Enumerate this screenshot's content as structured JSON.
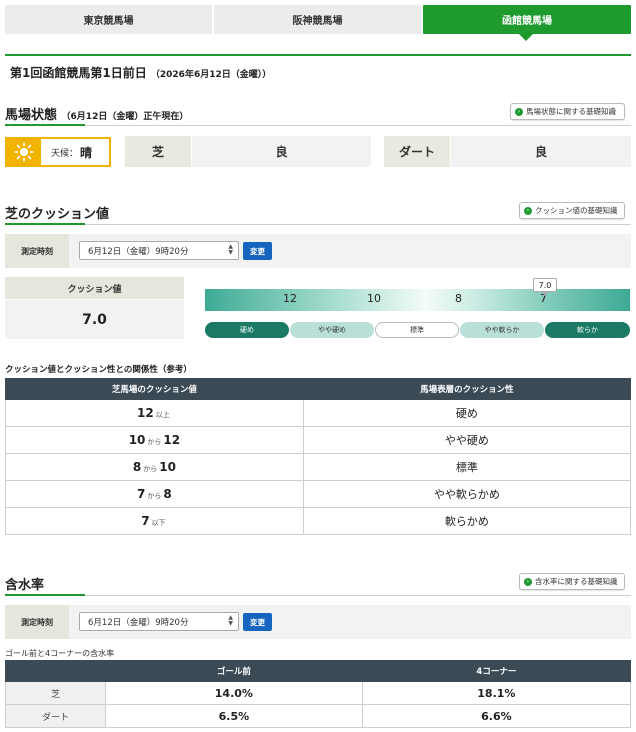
{
  "tabs": [
    {
      "label": "東京競馬場",
      "active": false
    },
    {
      "label": "阪神競馬場",
      "active": false
    },
    {
      "label": "函館競馬場",
      "active": true
    }
  ],
  "page_title": "第1回函館競馬第1日前日",
  "page_title_date": "（2026年6月12日（金曜））",
  "track_condition": {
    "title": "馬場状態",
    "as_of": "（6月12日（金曜）正午現在）",
    "info_button": "馬場状態に関する基礎知識",
    "weather_label": "天候：",
    "weather_value": "晴",
    "turf_label": "芝",
    "turf_value": "良",
    "dirt_label": "ダート",
    "dirt_value": "良"
  },
  "cushion": {
    "title": "芝のクッション値",
    "info_button": "クッション値の基礎知識",
    "measure_label": "測定時刻",
    "measure_value": "6月12日（金曜）9時20分",
    "change_button": "変更",
    "value_label": "クッション値",
    "value": "7.0",
    "scale_numbers": [
      "12",
      "10",
      "8",
      "7"
    ],
    "marker": "7.0",
    "categories": [
      "硬め",
      "やや硬め",
      "標準",
      "やや軟らか",
      "軟らか"
    ],
    "current_fraction": 0.8
  },
  "relation": {
    "title": "クッション値とクッション性との関係性（参考）",
    "headers": [
      "芝馬場のクッション値",
      "馬場表層のクッション性"
    ],
    "rows": [
      {
        "a": "12",
        "conj": "以上",
        "b": "",
        "result": "硬め"
      },
      {
        "a": "10",
        "conj": "から",
        "b": "12",
        "result": "やや硬め"
      },
      {
        "a": "8",
        "conj": "から",
        "b": "10",
        "result": "標準"
      },
      {
        "a": "7",
        "conj": "から",
        "b": "8",
        "result": "やや軟らかめ"
      },
      {
        "a": "7",
        "conj": "以下",
        "b": "",
        "result": "軟らかめ"
      }
    ]
  },
  "moisture": {
    "title": "含水率",
    "info_button": "含水率に関する基礎知識",
    "measure_label": "測定時刻",
    "measure_value": "6月12日（金曜）9時20分",
    "change_button": "変更",
    "note": "ゴール前と4コーナーの含水率",
    "headers": [
      "",
      "ゴール前",
      "4コーナー"
    ],
    "rows": [
      {
        "label": "芝",
        "goal": "14.0%",
        "corner": "18.1%"
      },
      {
        "label": "ダート",
        "goal": "6.5%",
        "corner": "6.6%"
      }
    ]
  }
}
